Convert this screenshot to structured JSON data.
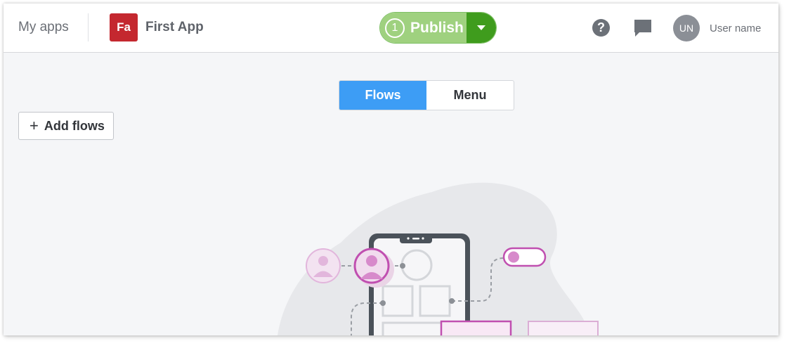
{
  "header": {
    "my_apps": "My apps",
    "app_badge": "Fa",
    "app_name": "First App",
    "publish_count": "1",
    "publish_label": "Publish",
    "user_initials": "UN",
    "user_name": "User name"
  },
  "tabs": [
    {
      "label": "Flows",
      "active": true
    },
    {
      "label": "Menu",
      "active": false
    }
  ],
  "actions": {
    "add_flows": "Add flows",
    "add_icon": "+"
  },
  "icons": {
    "help": "help-icon",
    "chat": "chat-icon",
    "dropdown": "chevron-down-icon"
  },
  "colors": {
    "publish_light": "#9fd17f",
    "publish_dark": "#3f9c1d",
    "active_tab": "#3d9df5",
    "app_badge": "#c4282f",
    "accent_pink": "#c04fb0"
  }
}
